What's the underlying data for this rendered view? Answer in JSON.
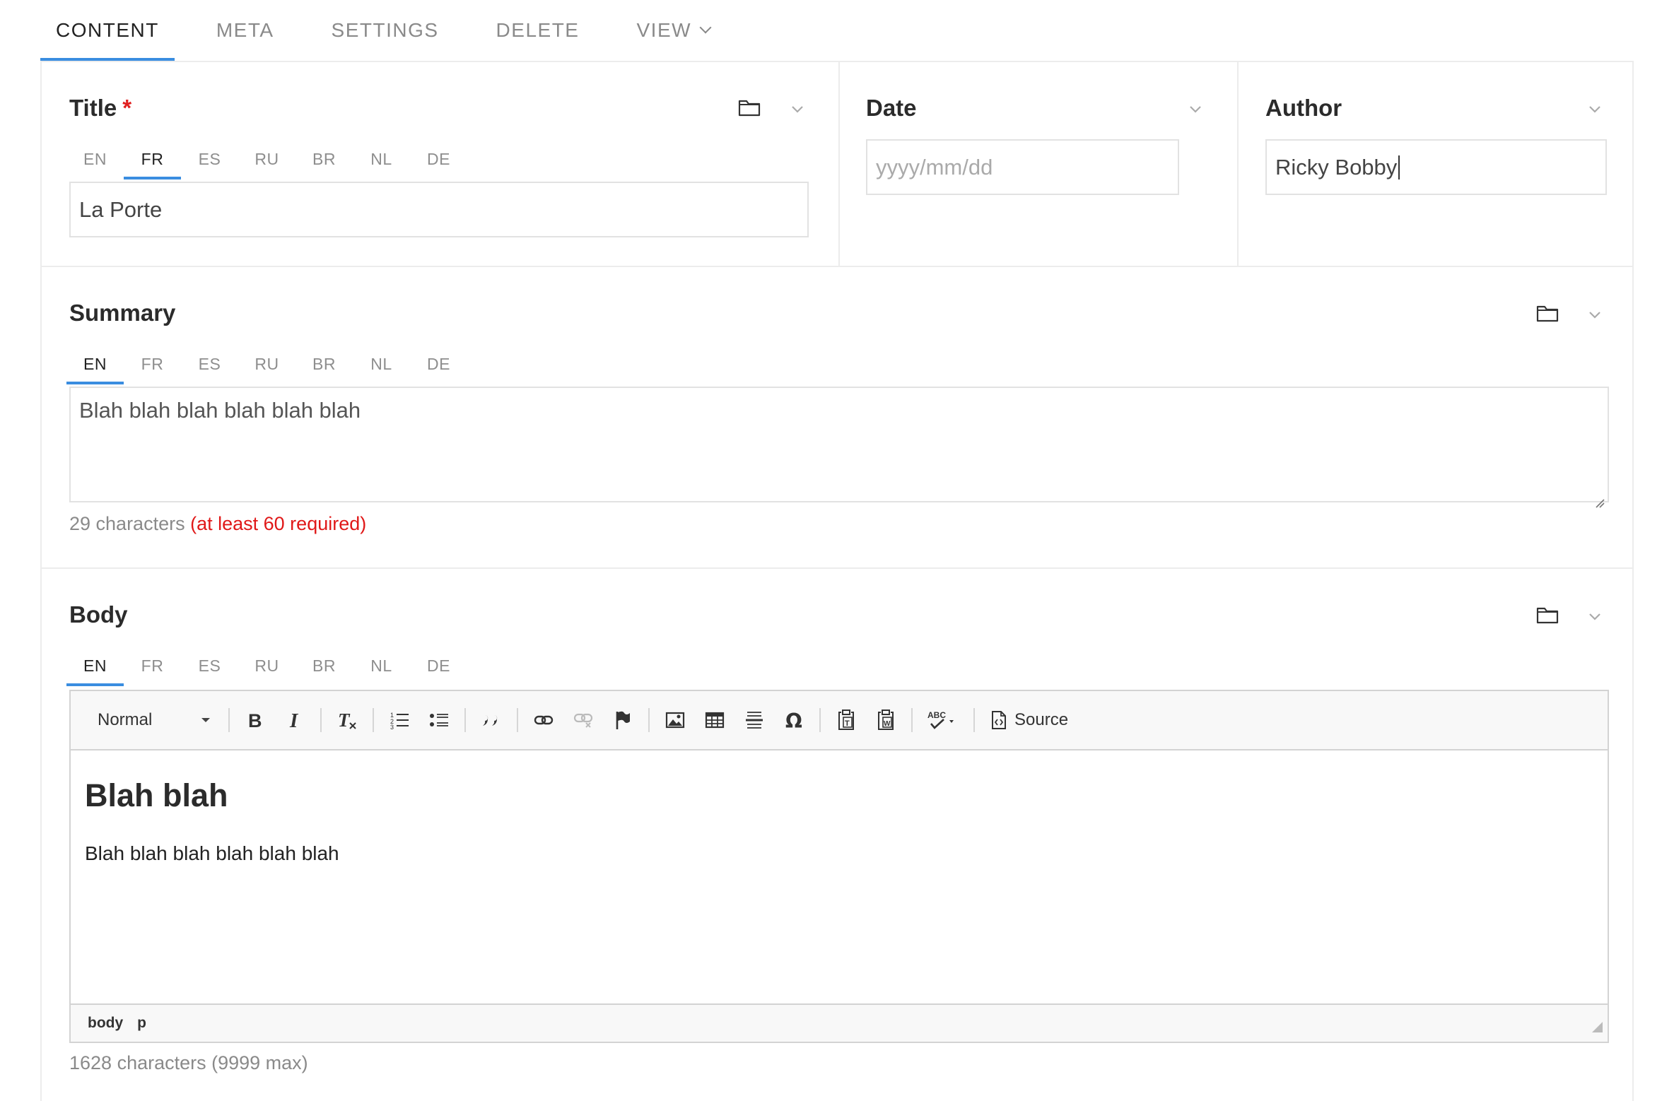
{
  "top_tabs": [
    {
      "label": "CONTENT",
      "active": true
    },
    {
      "label": "META"
    },
    {
      "label": "SETTINGS"
    },
    {
      "label": "DELETE"
    },
    {
      "label": "VIEW"
    }
  ],
  "languages": [
    "EN",
    "FR",
    "ES",
    "RU",
    "BR",
    "NL",
    "DE"
  ],
  "title_field": {
    "label": "Title",
    "required_mark": "*",
    "active_lang": "FR",
    "value": "La Porte"
  },
  "date_field": {
    "label": "Date",
    "placeholder": "yyyy/mm/dd",
    "value": ""
  },
  "author_field": {
    "label": "Author",
    "value": "Ricky Bobby"
  },
  "summary_field": {
    "label": "Summary",
    "active_lang": "EN",
    "value": "Blah blah blah blah blah blah",
    "count_text": "29 characters",
    "error_text": "(at least 60 required)"
  },
  "body_field": {
    "label": "Body",
    "active_lang": "EN",
    "format_select": "Normal",
    "source_label": "Source",
    "heading": "Blah blah",
    "paragraph": "Blah blah blah blah blah blah",
    "path": [
      "body",
      "p"
    ],
    "count_text": "1628 characters (9999 max)"
  },
  "colors": {
    "accent": "#3a8de0",
    "error": "#e01818"
  },
  "icons": [
    "folder-icon",
    "chevron-down-icon",
    "bold-icon",
    "italic-icon",
    "remove-format-icon",
    "numbered-list-icon",
    "bulleted-list-icon",
    "blockquote-icon",
    "link-icon",
    "unlink-icon",
    "anchor-icon",
    "image-icon",
    "table-icon",
    "horizontal-line-icon",
    "special-char-icon",
    "paste-text-icon",
    "paste-word-icon",
    "spellcheck-icon",
    "source-icon"
  ]
}
